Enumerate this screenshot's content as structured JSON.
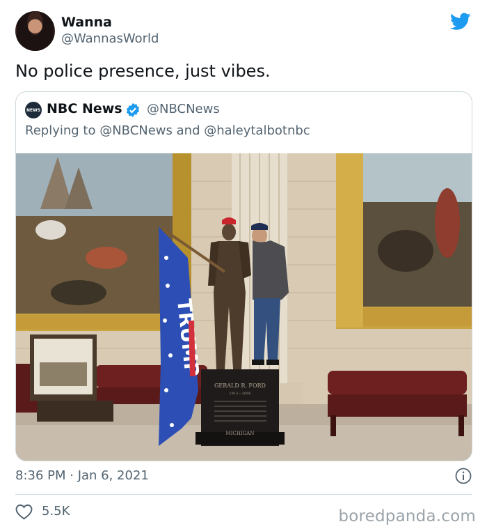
{
  "author": {
    "name": "Wanna",
    "handle": "@WannasWorld"
  },
  "tweet": {
    "text": "No police presence, just vibes.",
    "timestamp": "8:36 PM · Jan 6, 2021",
    "likes": "5.5K"
  },
  "quoted": {
    "name": "NBC News",
    "handle": "@NBCNews",
    "replying_to": "Replying to @NBCNews and @haleytalbotnbc",
    "photo": {
      "flag_text": "TRUMP",
      "pedestal_lines": [
        "GERALD R. FORD",
        "1913 – 2006",
        "MICHIGAN"
      ]
    }
  },
  "watermark": "boredpanda.com",
  "colors": {
    "twitter_blue": "#1d9bf0",
    "secondary_text": "#536471",
    "border": "#cfd9de"
  },
  "icons": [
    "twitter-bird-icon",
    "verified-badge-icon",
    "info-icon",
    "heart-icon",
    "nbc-news-logo"
  ]
}
